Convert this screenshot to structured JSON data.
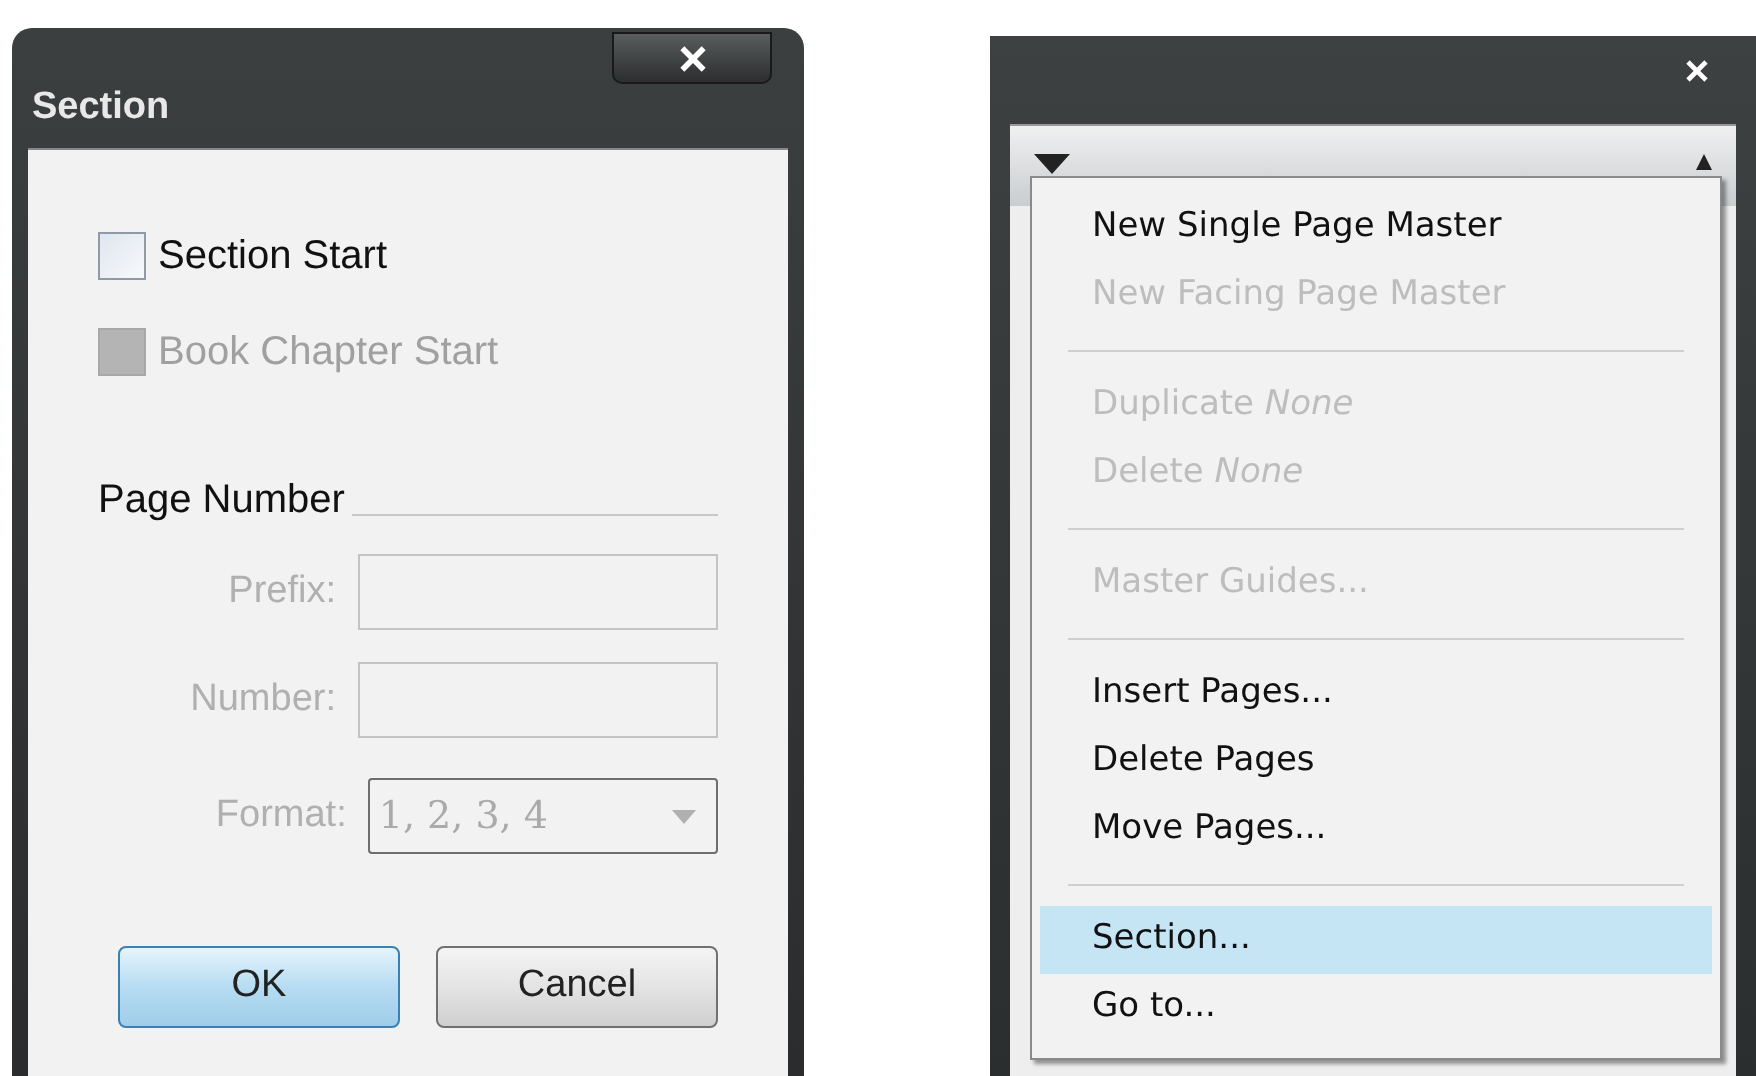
{
  "dialog": {
    "title": "Section",
    "checkboxes": [
      {
        "label": "Section Start",
        "checked": false,
        "disabled": false
      },
      {
        "label": "Book Chapter Start",
        "checked": false,
        "disabled": true
      }
    ],
    "group_label": "Page Number",
    "fields": [
      {
        "label": "Prefix:",
        "kind": "text",
        "disabled": true
      },
      {
        "label": "Number:",
        "kind": "text",
        "disabled": true
      },
      {
        "label": "Format:",
        "kind": "select",
        "value": "1, 2, 3, 4",
        "disabled": true
      }
    ],
    "buttons": [
      {
        "label": "OK",
        "default": true
      },
      {
        "label": "Cancel",
        "default": false
      }
    ]
  },
  "panel": {
    "menu": {
      "items": [
        {
          "kind": "item",
          "label": "New Single Page Master",
          "disabled": false,
          "selected": false
        },
        {
          "kind": "item",
          "label": "New Facing Page Master",
          "disabled": true,
          "selected": false
        },
        {
          "kind": "separator"
        },
        {
          "kind": "item",
          "label": "Duplicate *None*",
          "disabled": true,
          "selected": false
        },
        {
          "kind": "item",
          "label": "Delete *None*",
          "disabled": true,
          "selected": false
        },
        {
          "kind": "separator"
        },
        {
          "kind": "item",
          "label": "Master Guides...",
          "disabled": true,
          "selected": false
        },
        {
          "kind": "separator"
        },
        {
          "kind": "item",
          "label": "Insert Pages...",
          "disabled": false,
          "selected": false
        },
        {
          "kind": "item",
          "label": "Delete Pages",
          "disabled": false,
          "selected": false
        },
        {
          "kind": "item",
          "label": "Move Pages...",
          "disabled": false,
          "selected": false
        },
        {
          "kind": "separator"
        },
        {
          "kind": "item",
          "label": "Section...",
          "disabled": false,
          "selected": true
        },
        {
          "kind": "item",
          "label": "Go to...",
          "disabled": false,
          "selected": false
        }
      ]
    }
  }
}
